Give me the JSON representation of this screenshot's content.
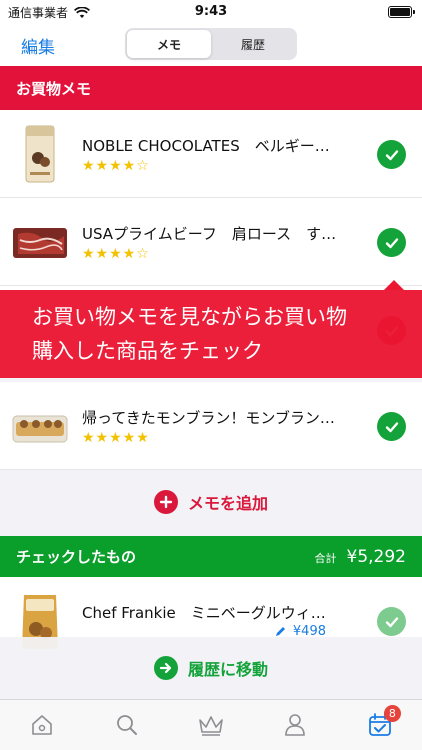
{
  "status_bar": {
    "carrier": "通信事業者",
    "time": "9:43"
  },
  "nav": {
    "edit_label": "編集",
    "segments": [
      "メモ",
      "履歴"
    ],
    "active_segment": 0
  },
  "memo_section": {
    "title": "お買物メモ"
  },
  "memo_items": [
    {
      "title": "NOBLE CHOCOLATES　ベルギー…",
      "stars": "★★★★☆"
    },
    {
      "title": "USAプライムビーフ　肩ロース　す…",
      "stars": "★★★★☆"
    },
    {
      "title": "帰ってきたモンブラン！モンブラン…",
      "stars": "★★★★★"
    }
  ],
  "banner": {
    "line1": "お買い物メモを見ながらお買い物",
    "line2": "購入した商品をチェック"
  },
  "add_memo_label": "メモを追加",
  "checked_section": {
    "title": "チェックしたもの",
    "total_label": "合計",
    "total_value": "¥5,292"
  },
  "checked_items": [
    {
      "title": "Chef Frankie　ミニベーグルウィ…",
      "price": "¥498"
    }
  ],
  "move_history_label": "履歴に移動",
  "tabs": [
    {
      "icon": "home-icon"
    },
    {
      "icon": "search-icon"
    },
    {
      "icon": "crown-icon"
    },
    {
      "icon": "person-icon"
    },
    {
      "icon": "calendar-check-icon",
      "badge": "8",
      "active": true
    }
  ],
  "colors": {
    "accent_red": "#e3123a",
    "accent_green": "#0a9e2a",
    "link_blue": "#1a7de3",
    "star": "#f2c200"
  }
}
